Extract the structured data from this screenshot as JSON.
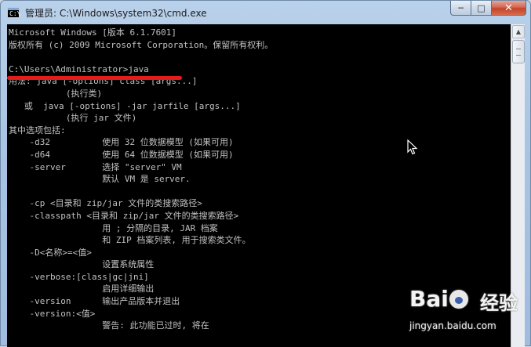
{
  "window": {
    "title": "管理员: C:\\Windows\\system32\\cmd.exe",
    "icon": "cmd-icon",
    "controls": {
      "minimize": "─",
      "maximize": "□",
      "close": "✕"
    }
  },
  "console": {
    "lines": [
      "Microsoft Windows [版本 6.1.7601]",
      "版权所有 (c) 2009 Microsoft Corporation。保留所有权利。",
      "",
      "C:\\Users\\Administrator>java",
      "用法: java [-options] class [args...]",
      "           (执行类)",
      "   或  java [-options] -jar jarfile [args...]",
      "           (执行 jar 文件)",
      "其中选项包括:",
      "    -d32          使用 32 位数据模型 (如果可用)",
      "    -d64          使用 64 位数据模型 (如果可用)",
      "    -server       选择 \"server\" VM",
      "                  默认 VM 是 server.",
      "",
      "    -cp <目录和 zip/jar 文件的类搜索路径>",
      "    -classpath <目录和 zip/jar 文件的类搜索路径>",
      "                  用 ; 分隔的目录, JAR 档案",
      "                  和 ZIP 档案列表, 用于搜索类文件。",
      "    -D<名称>=<值>",
      "                  设置系统属性",
      "    -verbose:[class|gc|jni]",
      "                  启用详细输出",
      "    -version      输出产品版本并退出",
      "    -version:<值>",
      "                  警告: 此功能已过时, 将在"
    ]
  },
  "watermark": {
    "brand_latin_1": "Bai",
    "brand_cn": "经验",
    "url": "jingyan.baidu.com"
  },
  "colors": {
    "console_bg": "#000000",
    "console_fg": "#c0c0c0",
    "annotation": "#e31b1b",
    "titlebar": "#b9d1ea",
    "close_button": "#c2442a"
  }
}
